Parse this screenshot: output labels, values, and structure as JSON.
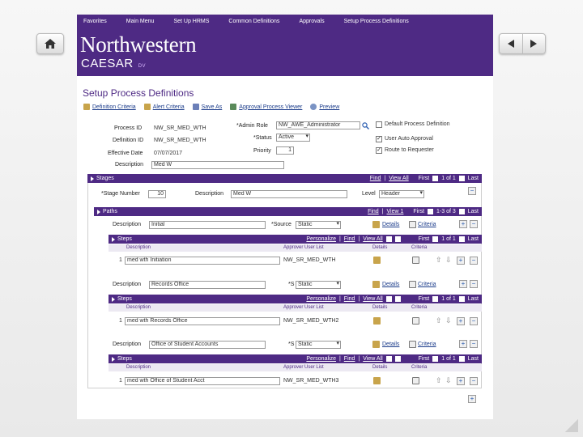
{
  "topnav": [
    "Favorites",
    "Main Menu",
    "Set Up HRMS",
    "Common Definitions",
    "Approvals",
    "Setup Process Definitions"
  ],
  "brand": {
    "name": "Northwestern",
    "app": "CAESAR",
    "env": "DV"
  },
  "page_title": "Setup Process Definitions",
  "toolbar": [
    "Definition Criteria",
    "Alert Criteria",
    "Save As",
    "Approval Process Viewer",
    "Preview"
  ],
  "form": {
    "process_id_label": "Process ID",
    "process_id": "NW_SR_MED_WTH",
    "definition_id_label": "Definition ID",
    "definition_id": "NW_SR_MED_WTH",
    "effective_date_label": "Effective Date",
    "effective_date": "07/07/2017",
    "description_label": "Description",
    "description": "Med W",
    "admin_role_label": "*Admin Role",
    "admin_role": "NW_AWE_Administrator",
    "status_label": "*Status",
    "status": "Active",
    "priority_label": "Priority",
    "priority": "1",
    "default_process_label": "Default Process Definition",
    "user_auto_approval_label": "User Auto Approval",
    "route_to_requester_label": "Route to Requester"
  },
  "stages": {
    "title": "Stages",
    "find": "Find",
    "view_all": "View All",
    "first": "First",
    "counter": "1 of 1",
    "last": "Last",
    "stage_number_label": "*Stage Number",
    "stage_number": "10",
    "description_label": "Description",
    "description": "Med W",
    "level_label": "Level",
    "level": "Header"
  },
  "paths": {
    "title": "Paths",
    "find": "Find",
    "view": "View 1",
    "first": "First",
    "counter": "1-3 of 3",
    "last": "Last",
    "items": [
      {
        "description": "Initial",
        "source_label": "*Source",
        "source": "Static",
        "steps_row": {
          "num": "1",
          "description": "med wth Initiation",
          "approver": "NW_SR_MED_WTH"
        }
      },
      {
        "description": "Records Office",
        "source_label": "*S",
        "source": "Static",
        "steps_row": {
          "num": "1",
          "description": "med wth Records Office",
          "approver": "NW_SR_MED_WTH2"
        }
      },
      {
        "description": "Office of Student Accounts",
        "source_label": "*S",
        "source": "Static",
        "steps_row": {
          "num": "1",
          "description": "med wth Office of Student Acct",
          "approver": "NW_SR_MED_WTH3"
        }
      }
    ]
  },
  "path_row": {
    "description_label": "Description",
    "details": "Details",
    "criteria": "Criteria"
  },
  "steps_bar": {
    "title": "Steps",
    "personalize": "Personalize",
    "find": "Find",
    "view_all": "View All",
    "first": "First",
    "counter": "1 of 1",
    "last": "Last"
  },
  "steps_cols": {
    "description": "Description",
    "approver": "Approver User List",
    "details": "Details",
    "criteria": "Criteria"
  },
  "colors": {
    "purple": "#4e2a84",
    "link": "#1a3b8a"
  }
}
